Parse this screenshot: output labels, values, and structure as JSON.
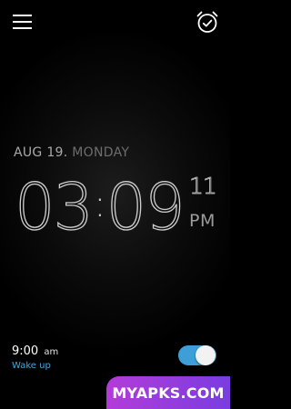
{
  "header": {
    "menu_icon": "hamburger-menu-icon",
    "alarm_icon": "alarm-clock-check-icon"
  },
  "clock": {
    "date": "AUG 19.",
    "day": "MONDAY",
    "hours": "03",
    "colon": ":",
    "minutes": "09",
    "seconds": "11",
    "ampm": "PM"
  },
  "alarm": {
    "time": "9:00",
    "ampm": "am",
    "label": "Wake up",
    "enabled": true
  },
  "watermark": {
    "text": "MYAPKS.COM"
  },
  "colors": {
    "accent": "#3e9fd8",
    "label_blue": "#4aa3df",
    "watermark_start": "#b33bd9",
    "watermark_end": "#7a3de0"
  }
}
